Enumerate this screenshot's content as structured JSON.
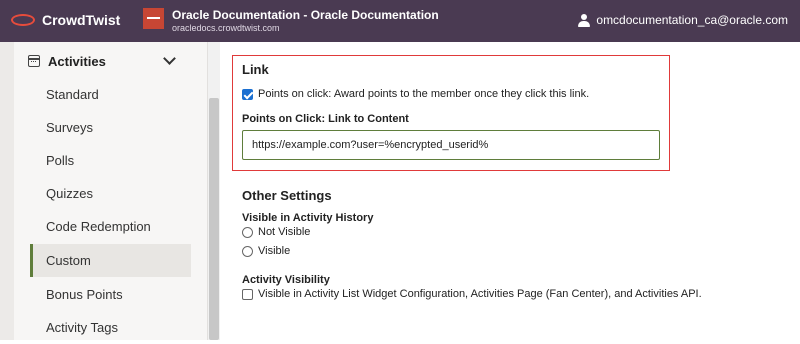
{
  "header": {
    "brand": "CrowdTwist",
    "org_title": "Oracle Documentation - Oracle Documentation",
    "org_subtitle": "oracledocs.crowdtwist.com",
    "user_email": "omcdocumentation_ca@oracle.com"
  },
  "sidebar": {
    "section_label": "Activities",
    "items": [
      {
        "label": "Standard"
      },
      {
        "label": "Surveys"
      },
      {
        "label": "Polls"
      },
      {
        "label": "Quizzes"
      },
      {
        "label": "Code Redemption"
      },
      {
        "label": "Custom",
        "active": true
      },
      {
        "label": "Bonus Points"
      },
      {
        "label": "Activity Tags"
      }
    ]
  },
  "link": {
    "title": "Link",
    "points_on_click_checked": true,
    "points_on_click_label": "Points on click: Award points to the member once they click this link.",
    "url_label": "Points on Click: Link to Content",
    "url_value": "https://example.com?user=%encrypted_userid%"
  },
  "other_settings": {
    "title": "Other Settings",
    "history_label": "Visible in Activity History",
    "history_options": [
      "Not Visible",
      "Visible"
    ],
    "visibility_label": "Activity Visibility",
    "visibility_checked": false,
    "visibility_option": "Visible in Activity List Widget Configuration, Activities Page (Fan Center), and Activities API."
  },
  "colors": {
    "header_bg": "#4a3a52",
    "brand_ring": "#e74c3c",
    "oracle_red": "#c74634",
    "highlight_border": "#e03a3a",
    "active_accent": "#5f7d3b",
    "checkbox_blue": "#1a6fd1"
  }
}
